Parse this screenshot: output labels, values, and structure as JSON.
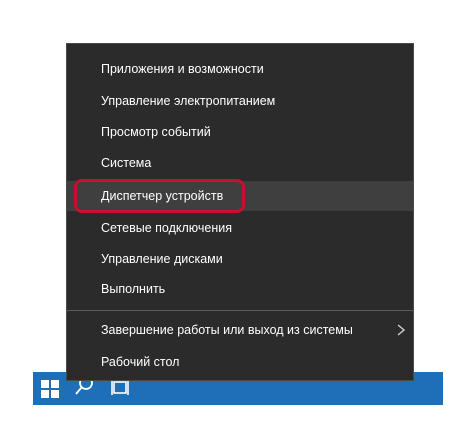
{
  "menu": {
    "items": [
      {
        "label": "Приложения и возможности"
      },
      {
        "label": "Управление электропитанием"
      },
      {
        "label": "Просмотр событий"
      },
      {
        "label": "Система"
      },
      {
        "label": "Диспетчер устройств"
      },
      {
        "label": "Сетевые подключения"
      },
      {
        "label": "Управление дисками"
      },
      {
        "label": "Выполнить"
      },
      {
        "label": "Завершение работы или выход из системы"
      },
      {
        "label": "Рабочий стол"
      }
    ]
  },
  "icons": {
    "start": "windows-logo-icon",
    "search": "search-icon",
    "task_view": "task-view-icon",
    "submenu": "chevron-right-icon"
  },
  "colors": {
    "menu_background": "#2b2b2b",
    "menu_hover": "#3f3f3f",
    "menu_text": "#ffffff",
    "taskbar": "#1f6fb8",
    "highlight_ring": "#c8102e"
  }
}
